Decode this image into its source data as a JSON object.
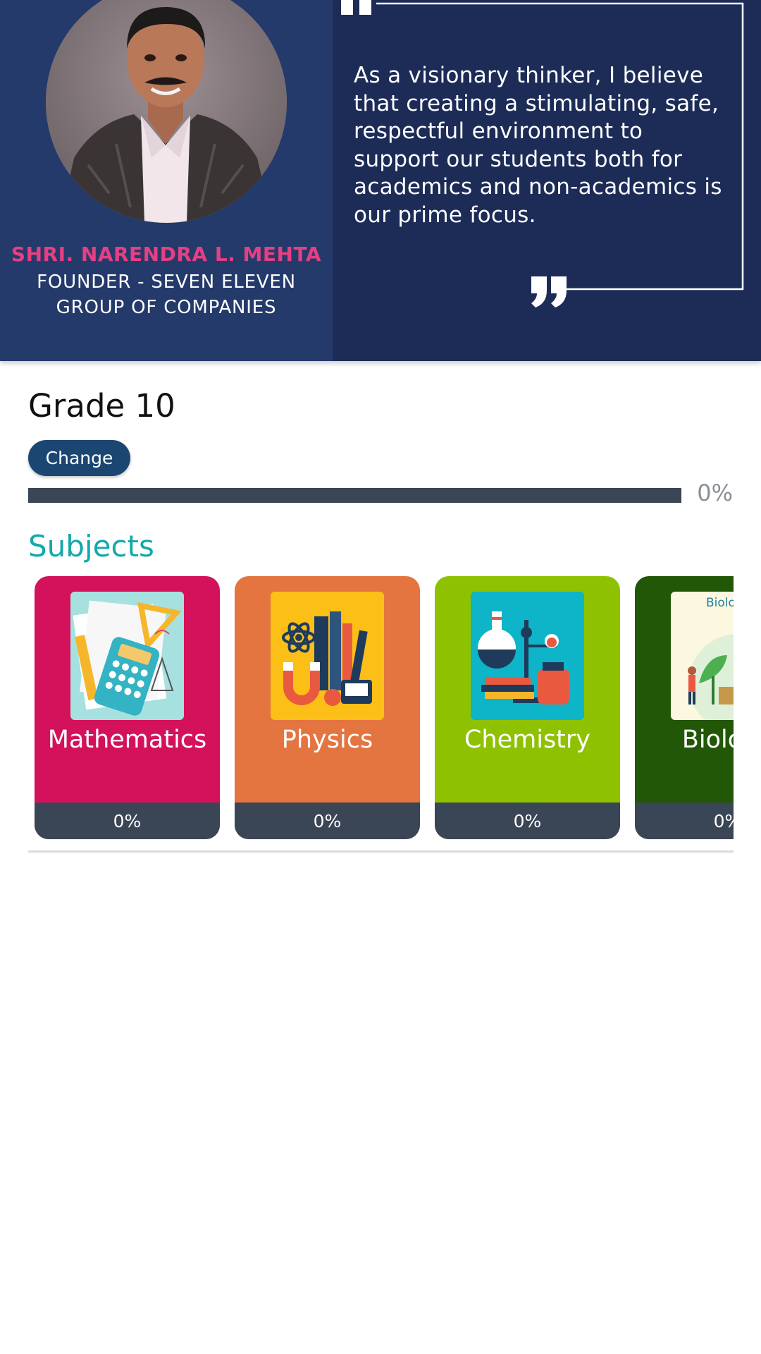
{
  "founder": {
    "name": "SHRI. NARENDRA L. MEHTA",
    "title_line1": "FOUNDER - SEVEN ELEVEN",
    "title_line2": "GROUP OF COMPANIES",
    "quote": "As a visionary thinker, I believe that creating a stimulating, safe, respectful environment to support our students both for academics and non-academics is our prime focus."
  },
  "grade": {
    "label": "Grade 10",
    "change_label": "Change",
    "progress_percent": 0,
    "progress_label": "0%"
  },
  "subjects": {
    "heading": "Subjects",
    "items": [
      {
        "name": "Mathematics",
        "progress": "0%",
        "color": "#d4115b",
        "icon": "calculator-icon"
      },
      {
        "name": "Physics",
        "progress": "0%",
        "color": "#e47440",
        "icon": "atom-magnet-icon"
      },
      {
        "name": "Chemistry",
        "progress": "0%",
        "color": "#8ec200",
        "icon": "flask-icon"
      },
      {
        "name": "Biology",
        "progress": "0%",
        "color": "#225707",
        "icon": "plant-icon",
        "image_caption": "Biology"
      }
    ]
  },
  "colors": {
    "hero_bg": "#1d2c57",
    "accent_pink": "#e63f82",
    "teal": "#12a9a9",
    "button": "#1c4672",
    "progress": "#3a4555"
  }
}
